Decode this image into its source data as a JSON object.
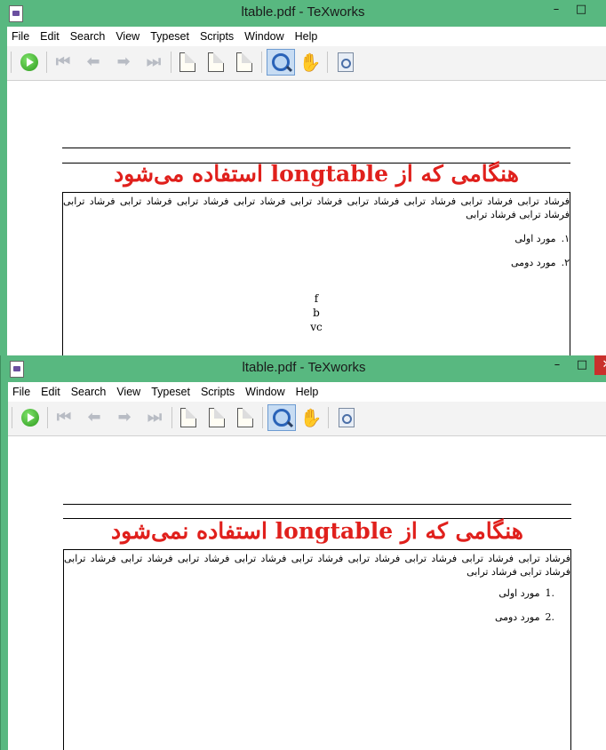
{
  "window_title": "ltable.pdf - TeXworks",
  "menu": [
    "File",
    "Edit",
    "Search",
    "View",
    "Typeset",
    "Scripts",
    "Window",
    "Help"
  ],
  "window_controls": {
    "minimize": "–",
    "maximize": "□",
    "close": "✕"
  },
  "window1": {
    "heading": "هنگامی که از longtable استفاده می‌شود",
    "paragraph": "فرشاد ترابی فرشاد ترابی فرشاد ترابی فرشاد ترابی فرشاد ترابی فرشاد ترابی فرشاد ترابی فرشاد ترابی فرشاد ترابی فرشاد ترابی فرشاد ترابی",
    "items": [
      {
        "num": "۱.",
        "text": "مورد اولی"
      },
      {
        "num": "۲.",
        "text": "مورد دومی"
      }
    ],
    "lines": [
      "f",
      "b",
      "vc"
    ]
  },
  "window2": {
    "heading": "هنگامی که از longtable استفاده نمی‌شود",
    "paragraph": "فرشاد ترابی فرشاد ترابی فرشاد ترابی فرشاد ترابی فرشاد ترابی فرشاد ترابی فرشاد ترابی فرشاد ترابی فرشاد ترابی فرشاد ترابی فرشاد ترابی",
    "items": [
      {
        "num": ".1",
        "text": "مورد اولی"
      },
      {
        "num": ".2",
        "text": "مورد دومی"
      }
    ]
  }
}
